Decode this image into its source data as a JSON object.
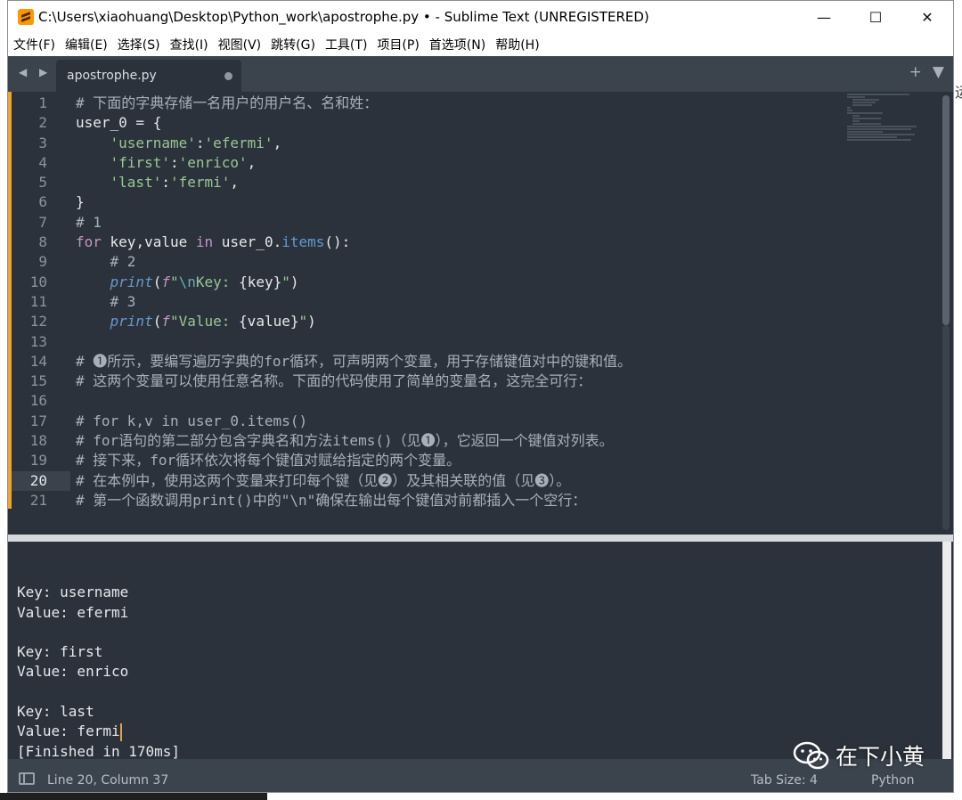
{
  "window": {
    "title": "C:\\Users\\xiaohuang\\Desktop\\Python_work\\apostrophe.py • - Sublime Text (UNREGISTERED)",
    "controls": {
      "minimize": "—",
      "maximize": "☐",
      "close": "✕"
    }
  },
  "menu": [
    "文件(F)",
    "编辑(E)",
    "选择(S)",
    "查找(I)",
    "视图(V)",
    "跳转(G)",
    "工具(T)",
    "项目(P)",
    "首选项(N)",
    "帮助(H)"
  ],
  "tabs": {
    "nav": "◀ ▶",
    "active": "apostrophe.py",
    "add": "+",
    "dropdown": "▼"
  },
  "editor": {
    "line_numbers": [
      "1",
      "2",
      "3",
      "4",
      "5",
      "6",
      "7",
      "8",
      "9",
      "10",
      "11",
      "12",
      "13",
      "14",
      "15",
      "16",
      "17",
      "18",
      "19",
      "20",
      "21"
    ],
    "active_line": "20",
    "lines": {
      "l1": "# 下面的字典存储一名用户的用户名、名和姓：",
      "l2a": "user_0",
      "l2b": " = {",
      "l3a": "    ",
      "l3b": "'username'",
      "l3c": ":",
      "l3d": "'efermi'",
      "l3e": ",",
      "l4a": "    ",
      "l4b": "'first'",
      "l4c": ":",
      "l4d": "'enrico'",
      "l4e": ",",
      "l5a": "    ",
      "l5b": "'last'",
      "l5c": ":",
      "l5d": "'fermi'",
      "l5e": ",",
      "l6": "}",
      "l7": "# 1",
      "l8a": "for",
      "l8b": " key,value ",
      "l8c": "in",
      "l8d": " user_0.",
      "l8e": "items",
      "l8f": "():",
      "l9": "    # 2",
      "l10a": "    ",
      "l10b": "print",
      "l10c": "(",
      "l10d": "f",
      "l10e": "\"",
      "l10f": "\\n",
      "l10g": "Key: ",
      "l10h": "{key}",
      "l10i": "\"",
      "l10j": ")",
      "l11": "    # 3",
      "l12a": "    ",
      "l12b": "print",
      "l12c": "(",
      "l12d": "f",
      "l12e": "\"Value: ",
      "l12f": "{value}",
      "l12g": "\"",
      "l12h": ")",
      "l13": "",
      "l14": "# ❶所示，要编写遍历字典的for循环，可声明两个变量，用于存储键值对中的键和值。",
      "l15": "# 这两个变量可以使用任意名称。下面的代码使用了简单的变量名，这完全可行：",
      "l16": "",
      "l17": "# for k,v in user_0.items()",
      "l18": "# for语句的第二部分包含字典名和方法items()（见❶），它返回一个键值对列表。",
      "l19": "# 接下来，for循环依次将每个键值对赋给指定的两个变量。",
      "l20": "# 在本例中，使用这两个变量来打印每个键（见❷）及其相关联的值（见❸）。",
      "l21": "# 第一个函数调用print()中的\"\\n\"确保在输出每个键值对前都插入一个空行："
    }
  },
  "output": {
    "lines": [
      "",
      "Key: username",
      "Value: efermi",
      "",
      "Key: first",
      "Value: enrico",
      "",
      "Key: last",
      "Value: fermi",
      "[Finished in 170ms]"
    ]
  },
  "status": {
    "position": "Line 20, Column 37",
    "tab_size": "Tab Size: 4",
    "syntax": "Python"
  },
  "watermark": {
    "text": "在下小黄"
  },
  "edge_text": "运",
  "colors": {
    "editor_bg": "#2b323b",
    "comment": "#a7b0ba",
    "keyword": "#c594c5",
    "string": "#99c794",
    "function": "#6699cc",
    "modified": "#e8a53a"
  }
}
